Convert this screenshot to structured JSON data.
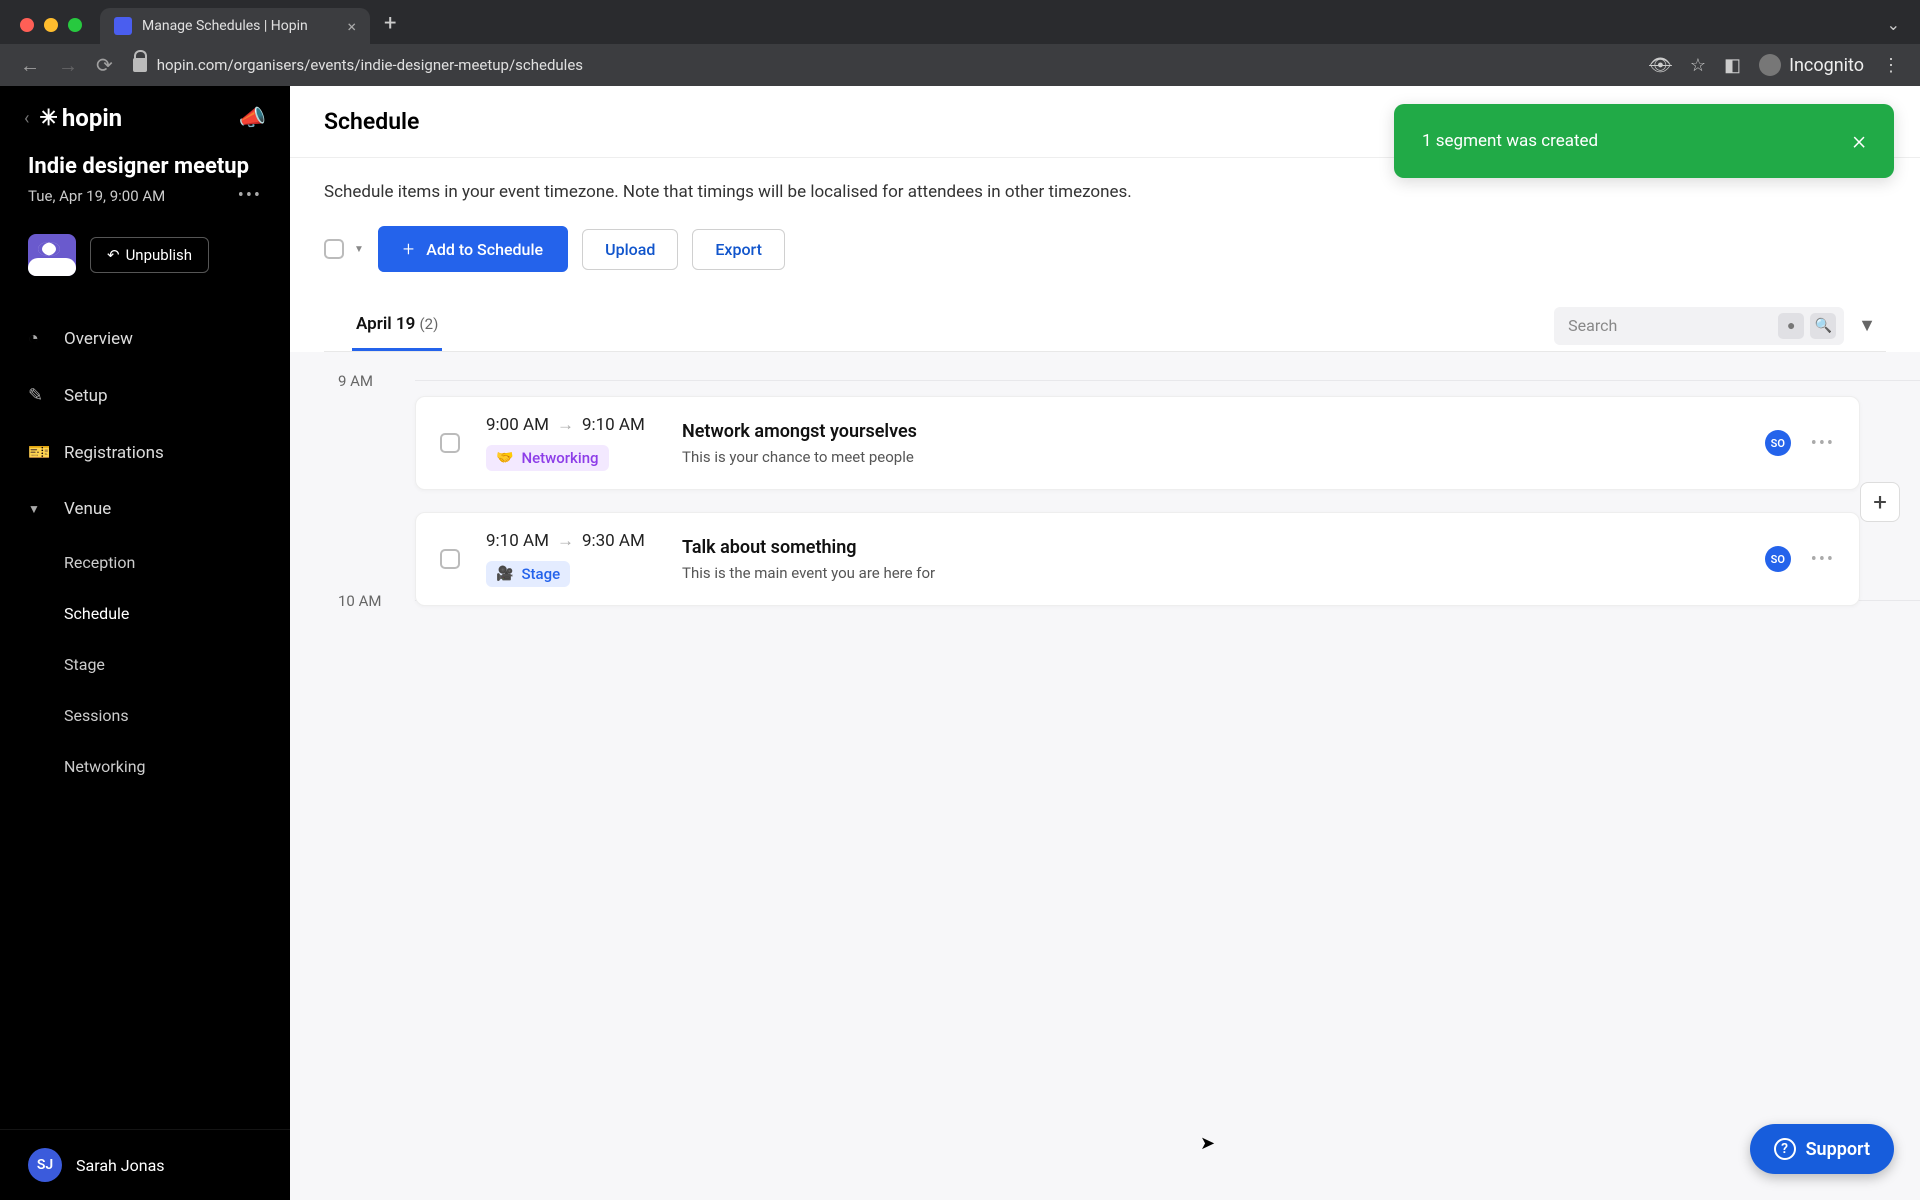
{
  "browser": {
    "tab_title": "Manage Schedules | Hopin",
    "url": "hopin.com/organisers/events/indie-designer-meetup/schedules",
    "incognito_label": "Incognito"
  },
  "sidebar": {
    "logo_text": "hopin",
    "event_title": "Indie designer meetup",
    "event_date": "Tue, Apr 19, 9:00 AM",
    "unpublish_label": "Unpublish",
    "nav": {
      "overview": "Overview",
      "setup": "Setup",
      "registrations": "Registrations",
      "venue": "Venue"
    },
    "venue_sub": {
      "reception": "Reception",
      "schedule": "Schedule",
      "stage": "Stage",
      "sessions": "Sessions",
      "networking": "Networking"
    },
    "user": {
      "initials": "SJ",
      "name": "Sarah Jonas"
    }
  },
  "page": {
    "title": "Schedule",
    "helper": "Schedule items in your event timezone. Note that timings will be localised for attendees in other timezones.",
    "add_button": "Add to Schedule",
    "upload_button": "Upload",
    "export_button": "Export",
    "date_tab_label": "April 19",
    "date_tab_count": "(2)",
    "search_placeholder": "Search"
  },
  "timeline": {
    "label_9": "9 AM",
    "label_10": "10 AM",
    "items": [
      {
        "start": "9:00 AM",
        "end": "9:10 AM",
        "tag": "Networking",
        "title": "Network amongst yourselves",
        "desc": "This is your chance to meet people",
        "badge": "SO"
      },
      {
        "start": "9:10 AM",
        "end": "9:30 AM",
        "tag": "Stage",
        "title": "Talk about something",
        "desc": "This is the main event you are here for",
        "badge": "SO"
      }
    ]
  },
  "toast": {
    "message": "1 segment was created"
  },
  "support": {
    "label": "Support"
  }
}
